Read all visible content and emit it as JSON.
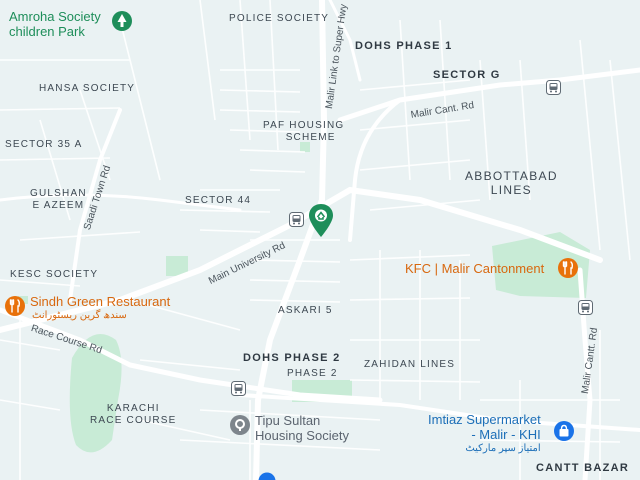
{
  "areas": {
    "police_society": "POLICE SOCIETY",
    "dohs_phase_1": "DOHS PHASE 1",
    "sector_g": "SECTOR G",
    "hansa_society": "HANSA SOCIETY",
    "paf_housing_1": "PAF HOUSING",
    "paf_housing_2": "SCHEME",
    "sector_35a": "SECTOR 35 A",
    "abbottabad_1": "ABBOTTABAD",
    "abbottabad_2": "LINES",
    "gulshan_1": "GULSHAN",
    "gulshan_2": "E AZEEM",
    "sector_44": "SECTOR 44",
    "kesc_society": "KESC SOCIETY",
    "askari_5": "ASKARI 5",
    "dohs_phase_2": "DOHS PHASE 2",
    "zahidan_lines": "ZAHIDAN LINES",
    "phase_2": "PHASE 2",
    "karachi_race_1": "KARACHI",
    "karachi_race_2": "RACE COURSE",
    "cantt_bazar": "CANTT BAZAR"
  },
  "roads": {
    "malir_link": "Malir Link to Super Hwy",
    "malir_cant_rd": "Malir Cant. Rd",
    "saadi_town_rd": "Saadi Town Rd",
    "main_university_rd": "Main University Rd",
    "race_course_rd": "Race Course Rd",
    "malir_cantt_rd_2": "Malir Cantt. Rd"
  },
  "pois": {
    "amroha_1": "Amroha Society",
    "amroha_2": "children Park",
    "kfc": "KFC | Malir Cantonment",
    "sindh_green": "Sindh Green Restaurant",
    "sindh_green_urdu": "سندھ گرین ریسٹورانٹ",
    "tipu_1": "Tipu Sultan",
    "tipu_2": "Housing Society",
    "imtiaz_1": "Imtiaz Supermarket",
    "imtiaz_2": "- Malir - KHI",
    "imtiaz_urdu": "امتیاز سپر مارکیٹ"
  },
  "colors": {
    "background": "#eaf2f3",
    "road": "#ffffff",
    "park": "#c5ead4",
    "poi_green": "#1e8e5a",
    "poi_orange": "#d8680f",
    "poi_blue": "#1d6fb8"
  },
  "icons": {
    "park_marker": "tree-icon",
    "restaurant_marker": "fork-knife-icon",
    "shopping_marker": "shopping-bag-icon",
    "transit": "bus-stop-icon",
    "place": "place-pin-icon",
    "selected": "location-pin-icon"
  }
}
